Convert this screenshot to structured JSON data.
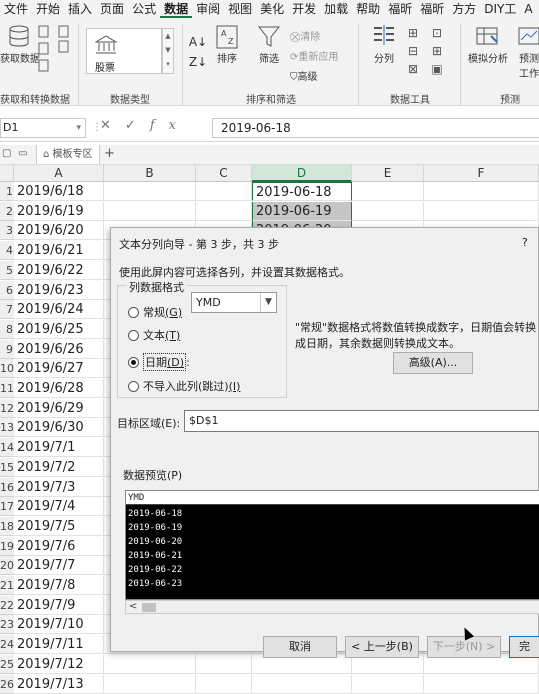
{
  "menu": [
    "文件",
    "开始",
    "插入",
    "页面",
    "公式",
    "数据",
    "审阅",
    "视图",
    "美化",
    "开发",
    "加载",
    "帮助",
    "福昕",
    "福昕",
    "方方",
    "DIY工",
    "A"
  ],
  "menu_active": "数据",
  "ribbon": {
    "get_data": "获取数据",
    "get_data_group": "获取和转换数据",
    "data_type": "股票",
    "data_type_group": "数据类型",
    "sort": "排序",
    "filter": "筛选",
    "clear": "清除",
    "reapply": "重新应用",
    "advanced": "高级",
    "sort_filter_group": "排序和筛选",
    "text_to_columns": "分列",
    "data_tools_group": "数据工具",
    "what_if": "模拟分析",
    "forecast_sheet": "预测\n工作",
    "forecast_group": "预测"
  },
  "formula": {
    "namebox": "D1",
    "value": "2019-06-18"
  },
  "tabs": {
    "template_zone": "模板专区",
    "add": "+"
  },
  "columns": [
    "A",
    "B",
    "C",
    "D",
    "E",
    "F"
  ],
  "rows": [
    "1",
    "2",
    "3",
    "4",
    "5",
    "6",
    "7",
    "8",
    "9",
    "10",
    "11",
    "12",
    "13",
    "14",
    "15",
    "16",
    "17",
    "18",
    "19",
    "20",
    "21",
    "22",
    "23",
    "24",
    "25",
    "26"
  ],
  "colA": [
    "2019/6/18",
    "2019/6/19",
    "2019/6/20",
    "2019/6/21",
    "2019/6/22",
    "2019/6/23",
    "2019/6/24",
    "2019/6/25",
    "2019/6/26",
    "2019/6/27",
    "2019/6/28",
    "2019/6/29",
    "2019/6/30",
    "2019/7/1",
    "2019/7/2",
    "2019/7/3",
    "2019/7/4",
    "2019/7/5",
    "2019/7/6",
    "2019/7/7",
    "2019/7/8",
    "2019/7/9",
    "2019/7/10",
    "2019/7/11",
    "2019/7/12",
    "2019/7/13"
  ],
  "colD": [
    "2019-06-18",
    "2019-06-19",
    "2019-06-20"
  ],
  "dialog": {
    "title": "文本分列向导 - 第 3 步，共 3 步",
    "help": "?",
    "description": "使用此屏内容可选择各列，并设置其数据格式。",
    "format_legend": "列数据格式",
    "opt_general": "常规",
    "opt_general_key": "(G)",
    "opt_text": "文本",
    "opt_text_key": "(T)",
    "opt_date": "日期",
    "opt_date_key": "(D)",
    "opt_date_colon": ":",
    "opt_skip": "不导入此列(跳过)",
    "opt_skip_key": "(I)",
    "date_format": "YMD",
    "hint": "\"常规\"数据格式将数值转换成数字，日期值会转换成日期，其余数据则转换成文本。",
    "advanced_btn": "高级(A)...",
    "dest_label": "目标区域(E):",
    "dest_value": "$D$1",
    "preview_label": "数据预览(P)",
    "preview_header": "YMD",
    "preview_rows": [
      "2019-06-18",
      "2019-06-19",
      "2019-06-20",
      "2019-06-21",
      "2019-06-22",
      "2019-06-23"
    ],
    "btn_cancel": "取消",
    "btn_back": "< 上一步(B)",
    "btn_next": "下一步(N) >",
    "btn_finish": "完"
  }
}
